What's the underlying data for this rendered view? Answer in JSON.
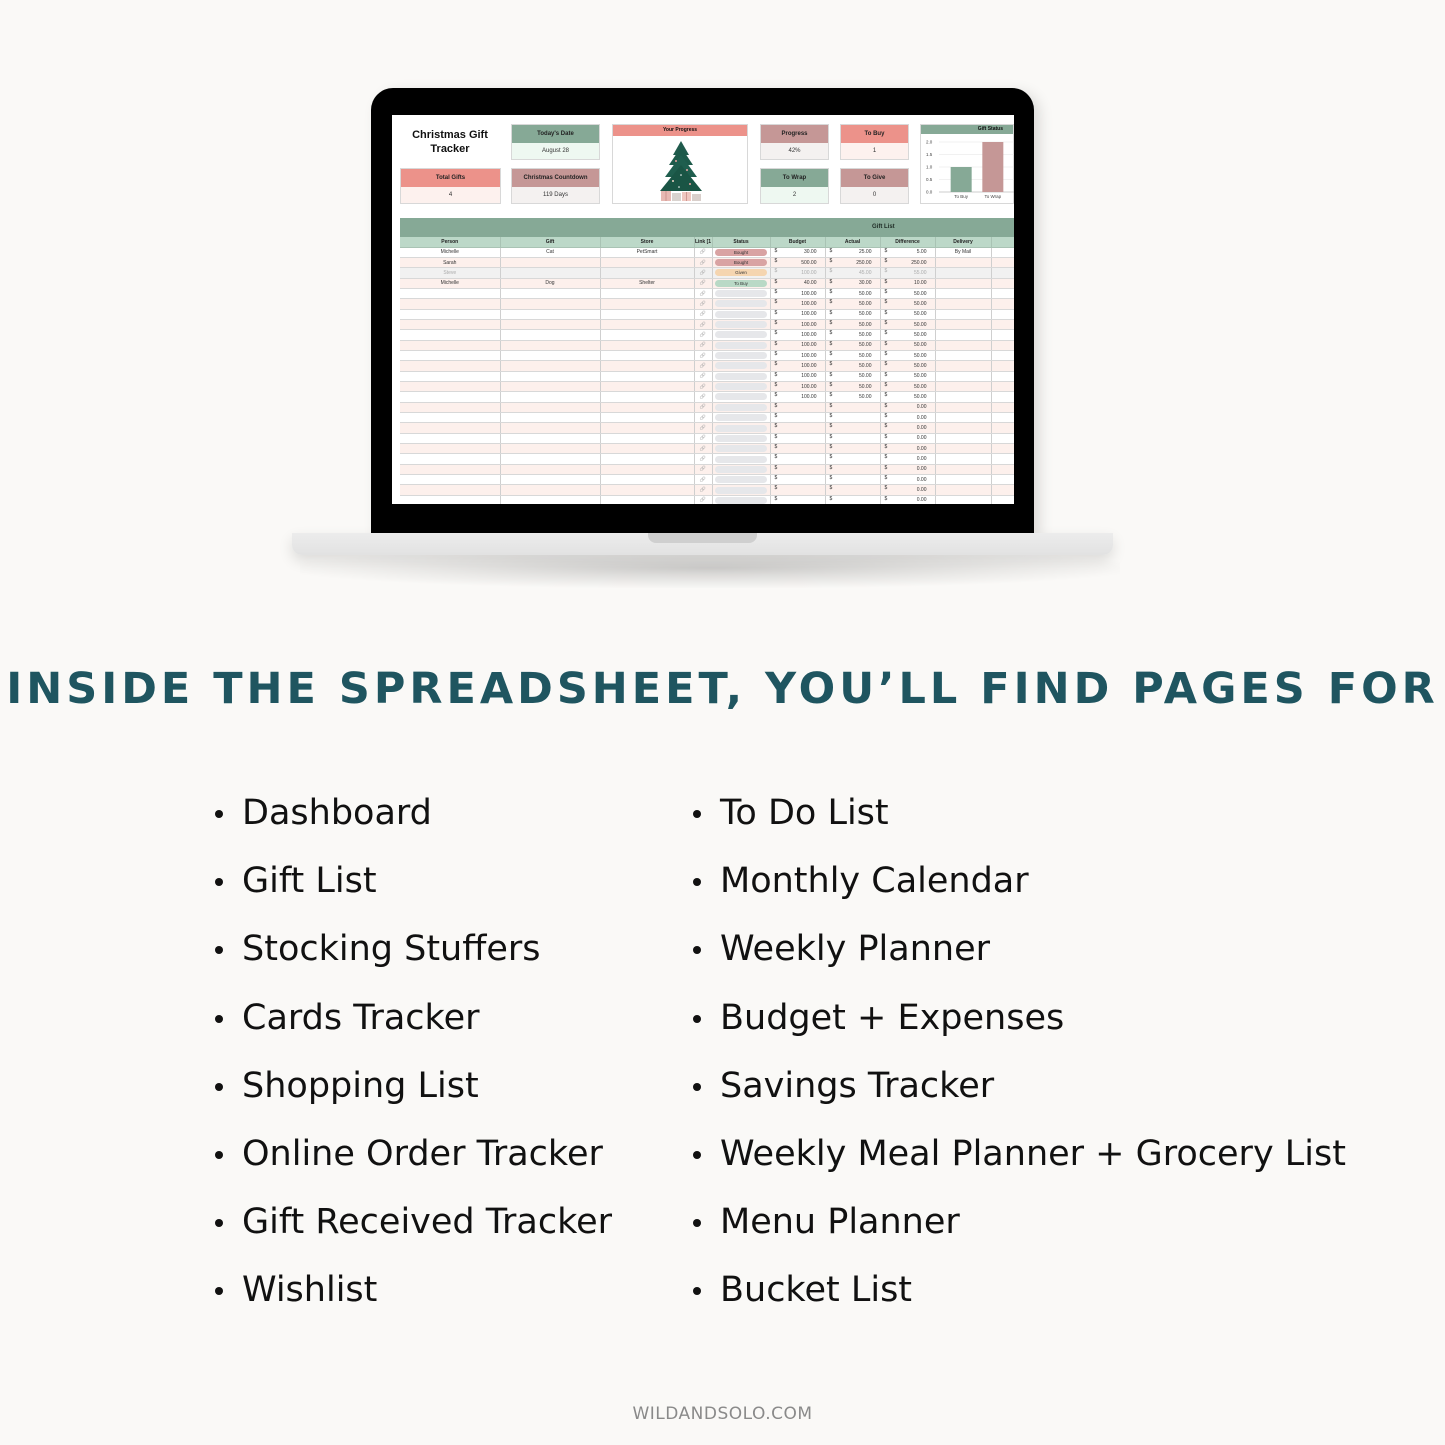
{
  "spreadsheet": {
    "title": "Christmas Gift Tracker",
    "cards": {
      "todays_date": {
        "label": "Today's Date",
        "value": "August 28"
      },
      "total_gifts": {
        "label": "Total Gifts",
        "value": "4"
      },
      "christmas_countdown": {
        "label": "Christmas Countdown",
        "value": "119 Days"
      },
      "your_progress": {
        "label": "Your Progress"
      },
      "progress": {
        "label": "Progress",
        "value": "42%"
      },
      "to_buy": {
        "label": "To Buy",
        "value": "1"
      },
      "to_wrap": {
        "label": "To Wrap",
        "value": "2"
      },
      "to_give": {
        "label": "To Give",
        "value": "0"
      }
    },
    "chart_data": {
      "type": "bar",
      "title": "Gift Status",
      "categories": [
        "To Buy",
        "To Wrap"
      ],
      "values": [
        1,
        2
      ],
      "colors": [
        "#86a996",
        "#c59796"
      ],
      "ylim": [
        0,
        2
      ],
      "yticks": [
        "0.0",
        "0.5",
        "1.0",
        "1.5",
        "2.0"
      ],
      "xlabel": "",
      "ylabel": "",
      "grid": true
    },
    "gift_list": {
      "title": "Gift List",
      "columns": [
        "Person",
        "Gift",
        "Store",
        "Link [1",
        "Status",
        "Budget",
        "Actual",
        "Difference",
        "Delivery"
      ],
      "currency_symbol": "$",
      "link_icon": "🔗",
      "status_colors": {
        "Bought": "#d9a3a3",
        "Given": "#f5d5b0",
        "To Buy": "#b9d9c6",
        "": "#e6e7ea"
      },
      "rows": [
        {
          "person": "Michelle",
          "gift": "Cat",
          "store": "PetSmart",
          "status": "Bought",
          "budget": "30.00",
          "actual": "25.00",
          "difference": "5.00",
          "delivery": "By Mail"
        },
        {
          "person": "Sarah",
          "gift": "",
          "store": "",
          "status": "Bought",
          "budget": "500.00",
          "actual": "250.00",
          "difference": "250.00",
          "delivery": ""
        },
        {
          "person": "Steve",
          "gift": "",
          "store": "",
          "status": "Given",
          "budget": "100.00",
          "actual": "45.00",
          "difference": "55.00",
          "delivery": ""
        },
        {
          "person": "Michelle",
          "gift": "Dog",
          "store": "Shelter",
          "status": "To Buy",
          "budget": "40.00",
          "actual": "30.00",
          "difference": "10.00",
          "delivery": ""
        },
        {
          "person": "",
          "gift": "",
          "store": "",
          "status": "",
          "budget": "100.00",
          "actual": "50.00",
          "difference": "50.00",
          "delivery": ""
        },
        {
          "person": "",
          "gift": "",
          "store": "",
          "status": "",
          "budget": "100.00",
          "actual": "50.00",
          "difference": "50.00",
          "delivery": ""
        },
        {
          "person": "",
          "gift": "",
          "store": "",
          "status": "",
          "budget": "100.00",
          "actual": "50.00",
          "difference": "50.00",
          "delivery": ""
        },
        {
          "person": "",
          "gift": "",
          "store": "",
          "status": "",
          "budget": "100.00",
          "actual": "50.00",
          "difference": "50.00",
          "delivery": ""
        },
        {
          "person": "",
          "gift": "",
          "store": "",
          "status": "",
          "budget": "100.00",
          "actual": "50.00",
          "difference": "50.00",
          "delivery": ""
        },
        {
          "person": "",
          "gift": "",
          "store": "",
          "status": "",
          "budget": "100.00",
          "actual": "50.00",
          "difference": "50.00",
          "delivery": ""
        },
        {
          "person": "",
          "gift": "",
          "store": "",
          "status": "",
          "budget": "100.00",
          "actual": "50.00",
          "difference": "50.00",
          "delivery": ""
        },
        {
          "person": "",
          "gift": "",
          "store": "",
          "status": "",
          "budget": "100.00",
          "actual": "50.00",
          "difference": "50.00",
          "delivery": ""
        },
        {
          "person": "",
          "gift": "",
          "store": "",
          "status": "",
          "budget": "100.00",
          "actual": "50.00",
          "difference": "50.00",
          "delivery": ""
        },
        {
          "person": "",
          "gift": "",
          "store": "",
          "status": "",
          "budget": "100.00",
          "actual": "50.00",
          "difference": "50.00",
          "delivery": ""
        },
        {
          "person": "",
          "gift": "",
          "store": "",
          "status": "",
          "budget": "100.00",
          "actual": "50.00",
          "difference": "50.00",
          "delivery": ""
        },
        {
          "person": "",
          "gift": "",
          "store": "",
          "status": "",
          "budget": "",
          "actual": "",
          "difference": "0.00",
          "delivery": ""
        },
        {
          "person": "",
          "gift": "",
          "store": "",
          "status": "",
          "budget": "",
          "actual": "",
          "difference": "0.00",
          "delivery": ""
        },
        {
          "person": "",
          "gift": "",
          "store": "",
          "status": "",
          "budget": "",
          "actual": "",
          "difference": "0.00",
          "delivery": ""
        },
        {
          "person": "",
          "gift": "",
          "store": "",
          "status": "",
          "budget": "",
          "actual": "",
          "difference": "0.00",
          "delivery": ""
        },
        {
          "person": "",
          "gift": "",
          "store": "",
          "status": "",
          "budget": "",
          "actual": "",
          "difference": "0.00",
          "delivery": ""
        },
        {
          "person": "",
          "gift": "",
          "store": "",
          "status": "",
          "budget": "",
          "actual": "",
          "difference": "0.00",
          "delivery": ""
        },
        {
          "person": "",
          "gift": "",
          "store": "",
          "status": "",
          "budget": "",
          "actual": "",
          "difference": "0.00",
          "delivery": ""
        },
        {
          "person": "",
          "gift": "",
          "store": "",
          "status": "",
          "budget": "",
          "actual": "",
          "difference": "0.00",
          "delivery": ""
        },
        {
          "person": "",
          "gift": "",
          "store": "",
          "status": "",
          "budget": "",
          "actual": "",
          "difference": "0.00",
          "delivery": ""
        },
        {
          "person": "",
          "gift": "",
          "store": "",
          "status": "",
          "budget": "",
          "actual": "",
          "difference": "0.00",
          "delivery": ""
        }
      ]
    }
  },
  "heading": "INSIDE THE SPREADSHEET, YOU’LL FIND PAGES FOR",
  "pages_left": [
    "Dashboard",
    "Gift List",
    "Stocking Stuffers",
    "Cards Tracker",
    "Shopping List",
    "Online Order Tracker",
    "Gift Received Tracker",
    "Wishlist"
  ],
  "pages_right": [
    "To Do List",
    "Monthly Calendar",
    "Weekly Planner",
    "Budget + Expenses",
    "Savings Tracker",
    "Weekly Meal Planner + Grocery List",
    "Menu Planner",
    "Bucket List"
  ],
  "footer": "WILDANDSOLO.COM",
  "colors": {
    "heading": "#1f5560",
    "green": "#86a996",
    "salmon": "#ec928a",
    "mauve": "#c59796",
    "background": "#faf9f7"
  }
}
